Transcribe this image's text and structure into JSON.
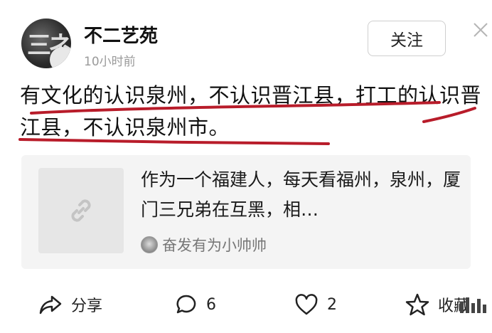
{
  "post": {
    "author": "不二艺苑",
    "time": "10小时前",
    "follow_label": "关注",
    "text": "有文化的认识泉州，不认识晋江县，打工的认识晋江县，不认识泉州市。"
  },
  "linked_card": {
    "text": "作为一个福建人，每天看福州，泉州，厦门三兄弟在互黑，相…",
    "author": "奋发有为小帅帅"
  },
  "actions": {
    "share_label": "分享",
    "comment_count": "6",
    "like_count": "2",
    "favorite_label": "收藏"
  },
  "colors": {
    "underline": "#b81c2a",
    "card_bg": "#f4f4f4"
  }
}
